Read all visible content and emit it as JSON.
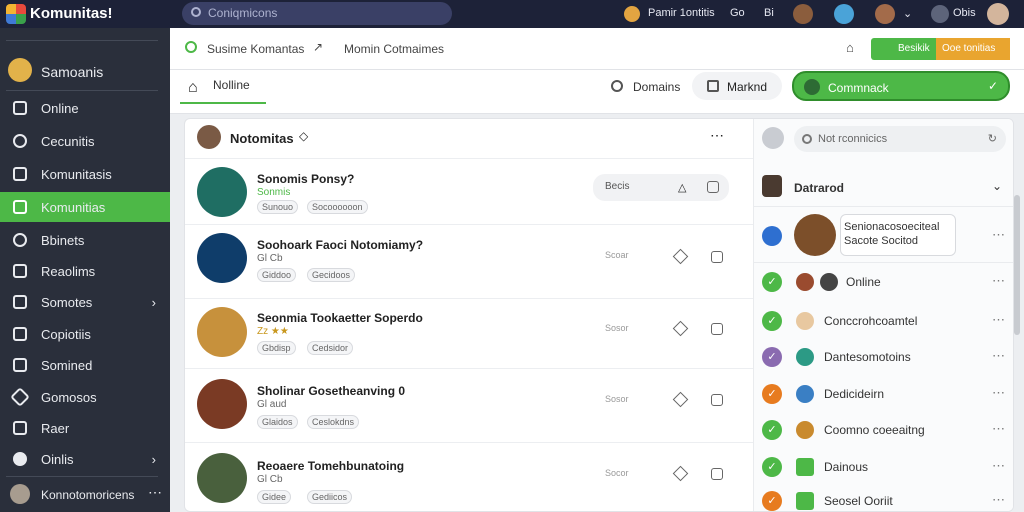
{
  "app": {
    "title": "Komunitas!",
    "search_placeholder": "Coniqmicons"
  },
  "topbar": {
    "coin_label": "Pamir 1ontitis",
    "a": "Go",
    "b": "Bi",
    "c": "Obis"
  },
  "sidebar": {
    "user_name": "Samoanis",
    "items": [
      {
        "label": "Online"
      },
      {
        "label": "Cecunitis"
      },
      {
        "label": "Komunitasis"
      },
      {
        "label": "Komunitias"
      },
      {
        "label": "Bbinets"
      },
      {
        "label": "Reaolims"
      },
      {
        "label": "Somotes"
      },
      {
        "label": "Copiotiis"
      },
      {
        "label": "Somined"
      },
      {
        "label": "Gomosos"
      },
      {
        "label": "Raer"
      },
      {
        "label": "Oinlis"
      }
    ],
    "footer_user": "Konnotomoricens"
  },
  "main": {
    "breadcrumb_a": "Susime Komantas",
    "breadcrumb_b": "Momin Cotmaimes",
    "top_action": "Besikik",
    "top_action2": "Ooe tonitias",
    "tabs": {
      "active": "Nolline",
      "domains": "Domains",
      "market": "Marknd"
    },
    "green_btn": "Commnack"
  },
  "list": {
    "header": "Notomitas",
    "rows": [
      {
        "title": "Sonomis Ponsy?",
        "sub": "Sonmis",
        "tag1": "Sunouo",
        "tag2": "Socoooooon",
        "action": "Becis"
      },
      {
        "title": "Soohoark Faoci Notomiamy?",
        "sub": "Gl Cb",
        "tag1": "Giddoo",
        "tag2": "Gecidoos",
        "action": "Scoar"
      },
      {
        "title": "Seonmia Tookaetter Soperdo",
        "sub": "Zz ★★",
        "tag1": "Gbdisp",
        "tag2": "Cedsidor",
        "action": "Sosor"
      },
      {
        "title": "Sholinar Gosetheanving 0",
        "sub": "Gl aud",
        "tag1": "Glaidos",
        "tag2": "Ceslokdns",
        "action": "Sosor"
      },
      {
        "title": "Reoaere Tomehbunatoing",
        "sub": "Gl Cb",
        "tag1": "Gidee",
        "tag2": "Gediicos",
        "action": "Socor"
      }
    ]
  },
  "right": {
    "search_placeholder": "Not rconnicics",
    "demand": "Datrarod",
    "profile_line1": "Senionacosoeciteal",
    "profile_line2": "Sacote Socitod",
    "items": [
      {
        "label": "Online"
      },
      {
        "label": "Conccrohcoamtel"
      },
      {
        "label": "Dantesomotoins"
      },
      {
        "label": "Dedicideirn"
      },
      {
        "label": "Coomno coeeaitng"
      },
      {
        "label": "Dainous"
      },
      {
        "label": "Seosel Ooriit"
      }
    ]
  }
}
